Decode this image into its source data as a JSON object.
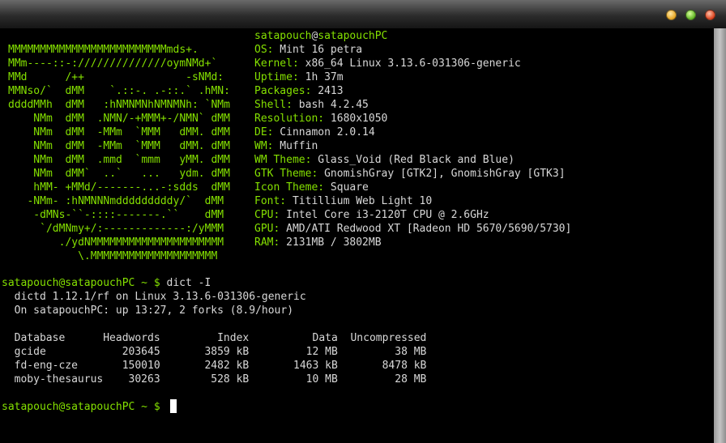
{
  "window": {
    "title": ""
  },
  "colors": {
    "accent_green": "#84e000",
    "text": "#d8d8d8",
    "background": "#000000"
  },
  "ascii_logo": [
    "MMMMMMMMMMMMMMMMMMMMMMMMMmds+.",
    "MMm----::-://////////////oymNMd+`",
    "MMd      /++                -sNMd:",
    "MMNso/`  dMM    `.::-. .-::.` .hMN:",
    "ddddMMh  dMM   :hNMNMNhNMNMNh: `NMm",
    "    NMm  dMM  .NMN/-+MMM+-/NMN` dMM",
    "    NMm  dMM  -MMm  `MMM   dMM. dMM",
    "    NMm  dMM  -MMm  `MMM   dMM. dMM",
    "    NMm  dMM  .mmd  `mmm   yMM. dMM",
    "    NMm  dMM`  ..`   ...   ydm. dMM",
    "    hMM- +MMd/-------...-:sdds  dMM",
    "   -NMm- :hNMNNNmdddddddddy/`  dMM",
    "    -dMNs-``-::::-------.``    dMM",
    "     `/dMNmy+/:-------------:/yMMM",
    "        ./ydNMMMMMMMMMMMMMMMMMMMMM",
    "           \\.MMMMMMMMMMMMMMMMMMMM"
  ],
  "sysinfo": {
    "user_host": {
      "user": "satapouch",
      "at": "@",
      "host": "satapouchPC"
    },
    "rows": [
      {
        "key": "OS:",
        "value": " Mint 16 petra"
      },
      {
        "key": "Kernel:",
        "value": " x86_64 Linux 3.13.6-031306-generic"
      },
      {
        "key": "Uptime:",
        "value": " 1h 37m"
      },
      {
        "key": "Packages:",
        "value": " 2413"
      },
      {
        "key": "Shell:",
        "value": " bash 4.2.45"
      },
      {
        "key": "Resolution:",
        "value": " 1680x1050"
      },
      {
        "key": "DE:",
        "value": " Cinnamon 2.0.14"
      },
      {
        "key": "WM:",
        "value": " Muffin"
      },
      {
        "key": "WM Theme:",
        "value": " Glass_Void (Red Black and Blue)"
      },
      {
        "key": "GTK Theme:",
        "value": " GnomishGray [GTK2], GnomishGray [GTK3]"
      },
      {
        "key": "Icon Theme:",
        "value": " Square"
      },
      {
        "key": "Font:",
        "value": " Titillium Web Light 10"
      },
      {
        "key": "CPU:",
        "value": " Intel Core i3-2120T CPU @ 2.6GHz"
      },
      {
        "key": "GPU:",
        "value": " AMD/ATI Redwood XT [Radeon HD 5670/5690/5730]"
      },
      {
        "key": "RAM:",
        "value": " 2131MB / 3802MB"
      }
    ]
  },
  "command1": {
    "prompt": "satapouch@satapouchPC ~ $",
    "command": " dict -I",
    "output": [
      "  dictd 1.12.1/rf on Linux 3.13.6-031306-generic",
      "  On satapouchPC: up 13:27, 2 forks (8.9/hour)"
    ]
  },
  "dict_table": {
    "header": "  Database      Headwords         Index          Data  Uncompressed",
    "rows": [
      "  gcide            203645       3859 kB         12 MB         38 MB",
      "  fd-eng-cze       150010       2482 kB       1463 kB       8478 kB",
      "  moby-thesaurus    30263        528 kB         10 MB         28 MB"
    ]
  },
  "command2": {
    "prompt": "satapouch@satapouchPC ~ $",
    "input": " "
  }
}
